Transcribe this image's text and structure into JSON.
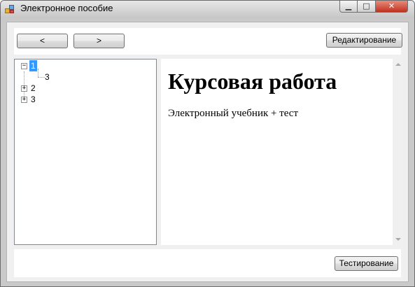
{
  "window": {
    "title": "Электронное пособие",
    "controls": {
      "minimize": "▁",
      "maximize": "□",
      "close": "✕"
    }
  },
  "toolbar": {
    "back_label": "<",
    "forward_label": ">",
    "edit_label": "Редактирование"
  },
  "tree": {
    "nodes": [
      {
        "label": "1",
        "expander": "−",
        "selected": true,
        "children": [
          {
            "label": "3"
          }
        ]
      },
      {
        "label": "2",
        "expander": "+"
      },
      {
        "label": "3",
        "expander": "+"
      }
    ]
  },
  "content": {
    "heading": "Курсовая работа",
    "text": "Электронный учебник + тест"
  },
  "footer": {
    "test_label": "Тестирование"
  },
  "colors": {
    "selection": "#3399ff",
    "panel_background": "#f0f0f0",
    "close_button": "#c0311e"
  }
}
